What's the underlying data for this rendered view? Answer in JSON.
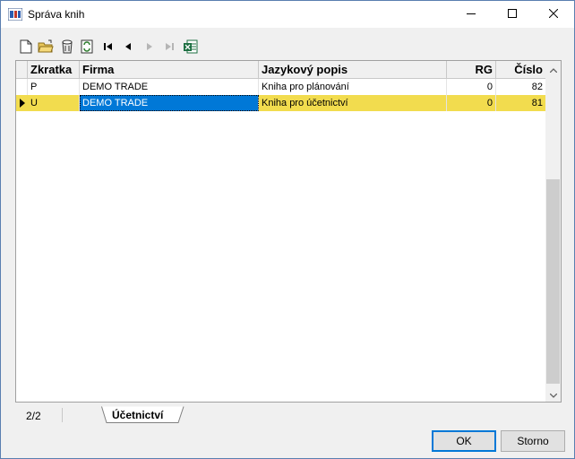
{
  "window": {
    "title": "Správa knih",
    "app_icon": "books-icon",
    "controls": [
      "minimize-icon",
      "maximize-icon",
      "close-icon"
    ]
  },
  "toolbar": {
    "buttons": [
      {
        "name": "new-icon"
      },
      {
        "name": "open-icon"
      },
      {
        "name": "filter-icon"
      },
      {
        "name": "refresh-icon"
      },
      {
        "name": "first-record-icon"
      },
      {
        "name": "prev-record-icon"
      },
      {
        "name": "next-record-icon",
        "disabled": true
      },
      {
        "name": "last-record-icon",
        "disabled": true
      },
      {
        "name": "excel-export-icon"
      }
    ]
  },
  "grid": {
    "columns": [
      "Zkratka",
      "Firma",
      "Jazykový popis",
      "RG",
      "Číslo"
    ],
    "rows": [
      {
        "zkratka": "P",
        "firma": "DEMO TRADE",
        "popis": "Kniha pro plánování",
        "rg": "0",
        "cislo": "82"
      },
      {
        "zkratka": "U",
        "firma": "DEMO TRADE",
        "popis": "Kniha pro účetnictví",
        "rg": "0",
        "cislo": "81"
      }
    ],
    "selected_row": 1,
    "highlight_color": "#f2dc4e",
    "focus_color": "#0078d7"
  },
  "statusbar": {
    "record_count": "2/2",
    "tab_label": "Účetnictví"
  },
  "buttons": {
    "ok": "OK",
    "cancel": "Storno"
  }
}
